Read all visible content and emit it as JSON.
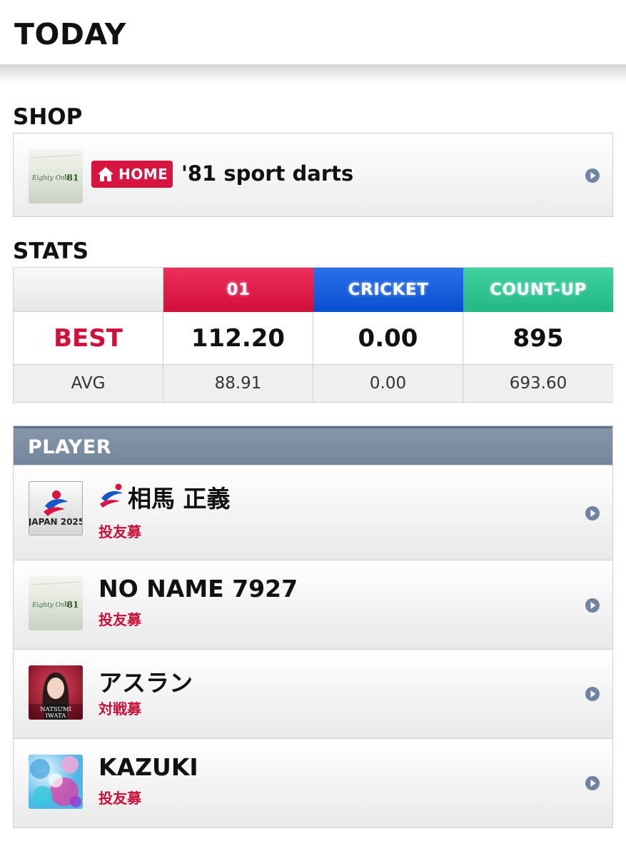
{
  "header": {
    "title": "TODAY"
  },
  "shop": {
    "section_title": "SHOP",
    "badge": "HOME",
    "name": "'81 sport darts",
    "logo_text": "Eighty One '81"
  },
  "stats": {
    "section_title": "STATS",
    "columns": [
      "01",
      "CRICKET",
      "COUNT-UP"
    ],
    "rows": [
      {
        "label": "BEST",
        "values": [
          "112.20",
          "0.00",
          "895"
        ]
      },
      {
        "label": "AVG",
        "values": [
          "88.91",
          "0.00",
          "693.60"
        ]
      }
    ]
  },
  "player": {
    "section_title": "PLAYER",
    "items": [
      {
        "name": "相馬 正義",
        "status": "投友募",
        "avatar": "japan-2025-logo",
        "avatar_text": "JAPAN 2025"
      },
      {
        "name": "NO NAME 7927",
        "status": "投友募",
        "avatar": "eighty-one-logo",
        "avatar_text": "Eighty One '81"
      },
      {
        "name": "アスラン",
        "status": "対戦募",
        "avatar": "natsumi-iwata-photo",
        "avatar_text": "NATSUMI IWATA"
      },
      {
        "name": "KAZUKI",
        "status": "投友募",
        "avatar": "colorful-abstract",
        "avatar_text": ""
      }
    ]
  },
  "colors": {
    "accent_red": "#d81540",
    "cricket_blue": "#0a4fd0",
    "countup_green": "#22b884",
    "player_header": "#7a8ba1",
    "arrow": "#6f84a3"
  }
}
